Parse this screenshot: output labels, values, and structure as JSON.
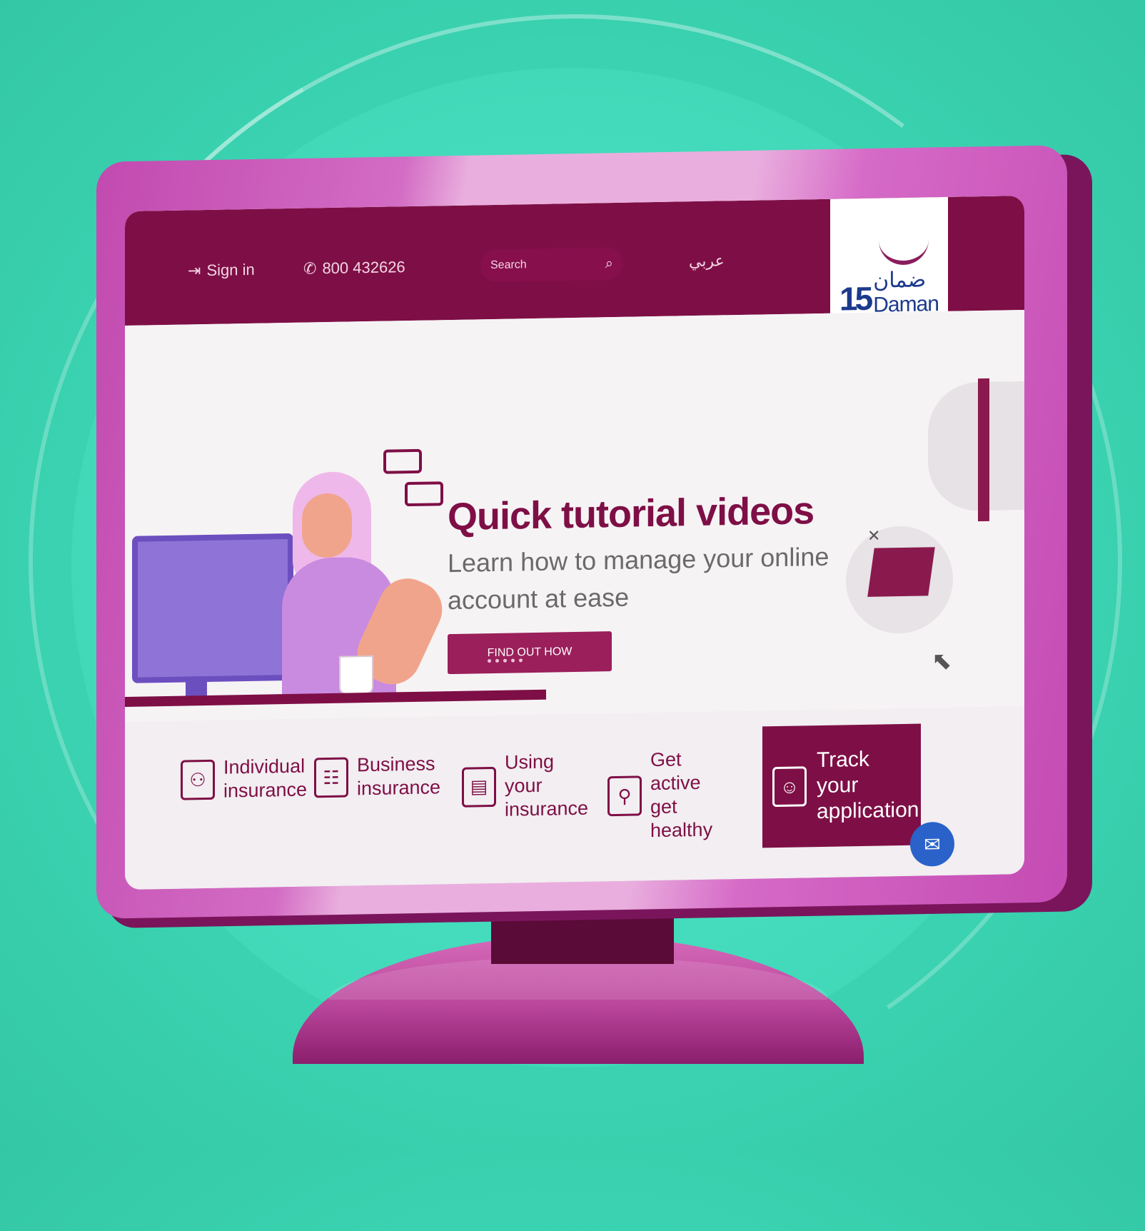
{
  "topbar": {
    "sign_in": "Sign in",
    "phone": "800 432626",
    "search_placeholder": "Search",
    "language": "عربي"
  },
  "logo": {
    "number": "15",
    "arabic": "ضمان",
    "english": "Daman"
  },
  "hero": {
    "title": "Quick tutorial videos",
    "subtitle": "Learn how to manage your online account at ease",
    "button": "FIND OUT HOW"
  },
  "nav": {
    "individual": "Individual insurance",
    "business": "Business insurance",
    "using": "Using your insurance",
    "active": "Get active get healthy",
    "track": "Track your application"
  },
  "icons": {
    "sign_in": "sign-in-icon",
    "phone": "phone-icon",
    "search": "search-icon",
    "chat": "chat-icon"
  },
  "colors": {
    "brand": "#7e0f46",
    "background": "#3dd8b6",
    "bezel": "#c24ab0",
    "chat": "#2a62c9"
  }
}
